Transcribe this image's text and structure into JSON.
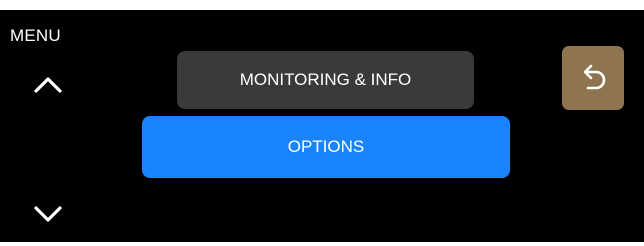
{
  "screen": {
    "title": "MENU"
  },
  "menu": {
    "items": [
      {
        "label": "MONITORING & INFO",
        "state": "normal"
      },
      {
        "label": "OPTIONS",
        "state": "selected"
      }
    ]
  },
  "nav": {
    "up_icon": "chevron-up-icon",
    "down_icon": "chevron-down-icon"
  },
  "back": {
    "icon": "undo-arrow-icon"
  },
  "colors": {
    "background": "#000000",
    "item_normal": "#3a3a3a",
    "item_selected": "#1a84ff",
    "back_button": "#8e7550",
    "text": "#ffffff"
  }
}
